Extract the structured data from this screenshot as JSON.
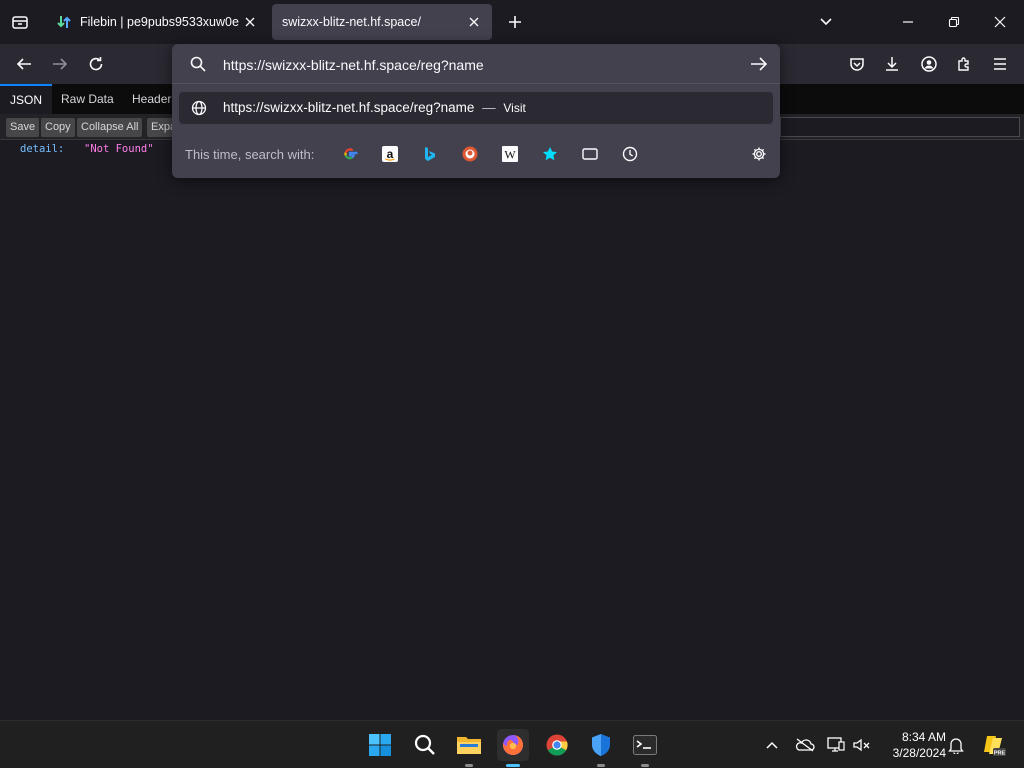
{
  "browser": {
    "tabs": [
      {
        "title": "Filebin | pe9pubs9533xuw0e",
        "active": false
      },
      {
        "title": "swizxx-blitz-net.hf.space/",
        "active": true
      }
    ]
  },
  "urlbar": {
    "value": "https://swizxx-blitz-net.hf.space/reg?name",
    "result": {
      "url": "https://swizxx-blitz-net.hf.space/reg?name",
      "separator": "—",
      "action": "Visit"
    },
    "search_with_label": "This time, search with:",
    "engines": [
      "google-icon",
      "amazon-icon",
      "bing-icon",
      "duckduckgo-icon",
      "wikipedia-icon",
      "bookmarks-star-icon",
      "tabs-icon",
      "history-icon"
    ]
  },
  "json_viewer": {
    "tabs": [
      "JSON",
      "Raw Data",
      "Headers"
    ],
    "toolbar": {
      "save": "Save",
      "copy": "Copy",
      "collapse_all": "Collapse All",
      "expand_all": "Expand All"
    },
    "rows": [
      {
        "key": "detail:",
        "value": "\"Not Found\""
      }
    ]
  },
  "taskbar": {
    "clock_time": "8:34 AM",
    "clock_date": "3/28/2024"
  },
  "colors": {
    "accent": "#0a84ff",
    "json_key": "#75bfff",
    "json_string": "#ff7de9",
    "active_indicator": "#4cc2ff"
  }
}
